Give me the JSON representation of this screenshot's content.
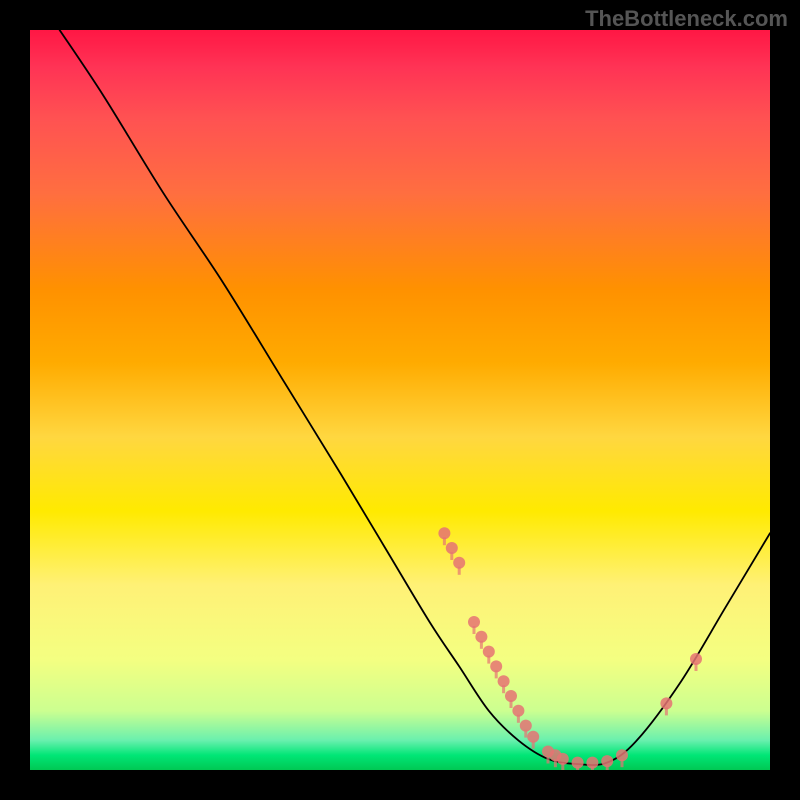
{
  "watermark": "TheBottleneck.com",
  "chart_data": {
    "type": "line",
    "title": "",
    "xlabel": "",
    "ylabel": "",
    "xlim": [
      0,
      100
    ],
    "ylim": [
      0,
      100
    ],
    "series": [
      {
        "name": "bottleneck-curve",
        "points": [
          {
            "x": 4,
            "y": 100
          },
          {
            "x": 10,
            "y": 91
          },
          {
            "x": 18,
            "y": 78
          },
          {
            "x": 26,
            "y": 66
          },
          {
            "x": 34,
            "y": 53
          },
          {
            "x": 42,
            "y": 40
          },
          {
            "x": 48,
            "y": 30
          },
          {
            "x": 54,
            "y": 20
          },
          {
            "x": 58,
            "y": 14
          },
          {
            "x": 62,
            "y": 8
          },
          {
            "x": 66,
            "y": 4
          },
          {
            "x": 70,
            "y": 1.5
          },
          {
            "x": 74,
            "y": 0.8
          },
          {
            "x": 78,
            "y": 1
          },
          {
            "x": 82,
            "y": 4
          },
          {
            "x": 88,
            "y": 12
          },
          {
            "x": 94,
            "y": 22
          },
          {
            "x": 100,
            "y": 32
          }
        ]
      }
    ],
    "markers": [
      {
        "x": 56,
        "y": 32
      },
      {
        "x": 57,
        "y": 30
      },
      {
        "x": 58,
        "y": 28
      },
      {
        "x": 60,
        "y": 20
      },
      {
        "x": 61,
        "y": 18
      },
      {
        "x": 62,
        "y": 16
      },
      {
        "x": 63,
        "y": 14
      },
      {
        "x": 64,
        "y": 12
      },
      {
        "x": 65,
        "y": 10
      },
      {
        "x": 66,
        "y": 8
      },
      {
        "x": 67,
        "y": 6
      },
      {
        "x": 68,
        "y": 4.5
      },
      {
        "x": 70,
        "y": 2.5
      },
      {
        "x": 71,
        "y": 2
      },
      {
        "x": 72,
        "y": 1.5
      },
      {
        "x": 74,
        "y": 1
      },
      {
        "x": 76,
        "y": 1
      },
      {
        "x": 78,
        "y": 1.2
      },
      {
        "x": 80,
        "y": 2
      },
      {
        "x": 86,
        "y": 9
      },
      {
        "x": 90,
        "y": 15
      }
    ]
  }
}
